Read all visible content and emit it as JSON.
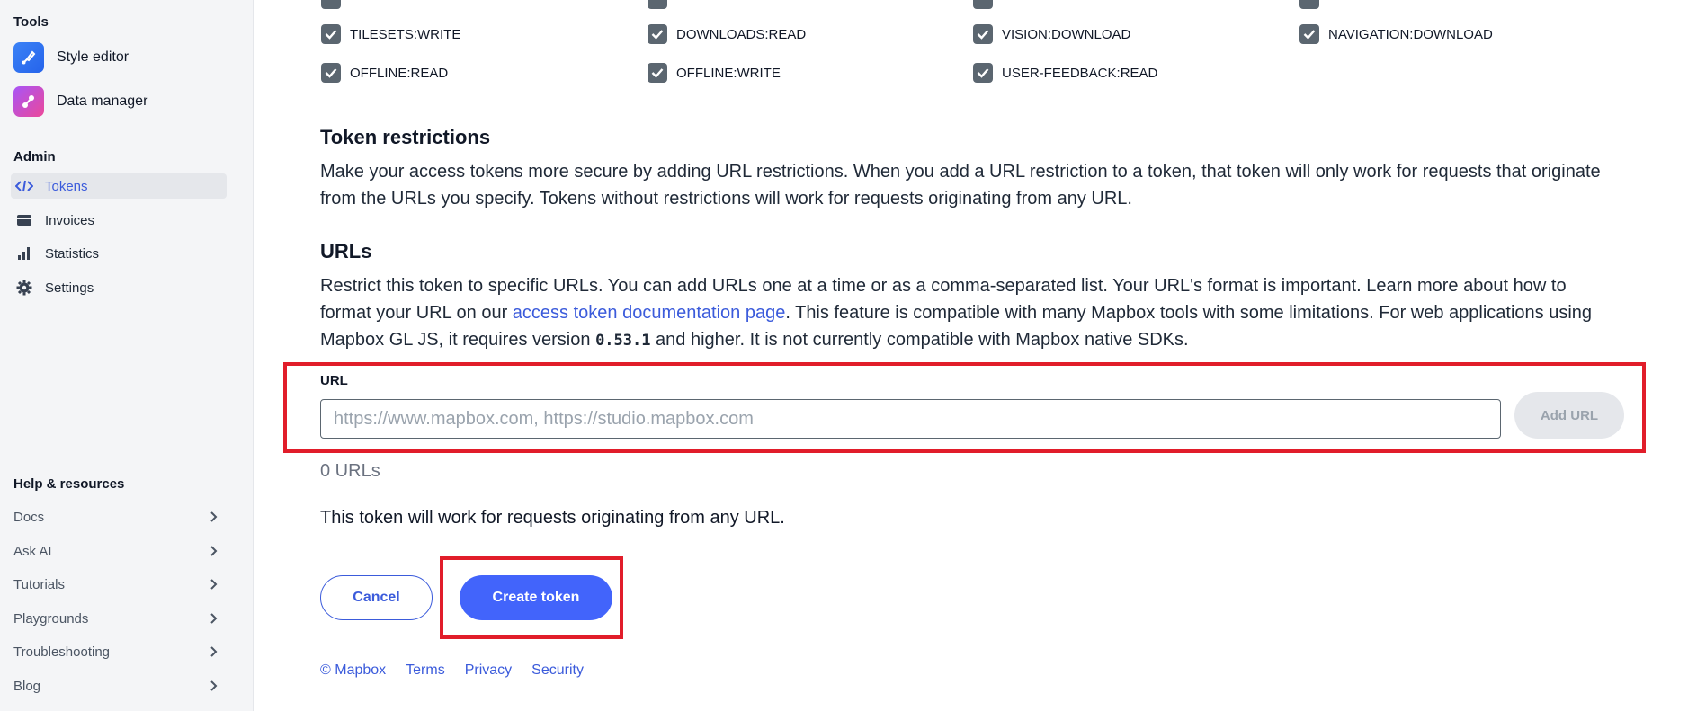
{
  "sidebar": {
    "tools_heading": "Tools",
    "tools": [
      {
        "label": "Style editor",
        "icon": "style-editor-icon"
      },
      {
        "label": "Data manager",
        "icon": "data-manager-icon"
      }
    ],
    "admin_heading": "Admin",
    "admin_items": [
      {
        "label": "Tokens",
        "icon": "code-brackets-icon",
        "active": true
      },
      {
        "label": "Invoices",
        "icon": "card-icon",
        "active": false
      },
      {
        "label": "Statistics",
        "icon": "bar-chart-icon",
        "active": false
      },
      {
        "label": "Settings",
        "icon": "gear-icon",
        "active": false
      }
    ],
    "help_heading": "Help & resources",
    "help_items": [
      "Docs",
      "Ask AI",
      "Tutorials",
      "Playgrounds",
      "Troubleshooting",
      "Blog"
    ]
  },
  "scopes": {
    "row1": [
      "TILESETS:WRITE",
      "DOWNLOADS:READ",
      "VISION:DOWNLOAD",
      "NAVIGATION:DOWNLOAD"
    ],
    "row2": [
      "OFFLINE:READ",
      "OFFLINE:WRITE",
      "USER-FEEDBACK:READ"
    ]
  },
  "restrictions": {
    "heading": "Token restrictions",
    "text": "Make your access tokens more secure by adding URL restrictions. When you add a URL restriction to a token, that token will only work for requests that originate from the URLs you specify. Tokens without restrictions will work for requests originating from any URL."
  },
  "urls": {
    "heading": "URLs",
    "text_before_link": "Restrict this token to specific URLs. You can add URLs one at a time or as a comma-separated list. Your URL's format is important. Learn more about how to format your URL on our ",
    "link_text": "access token documentation page",
    "text_after_link": ". This feature is compatible with many Mapbox tools with some limitations. For web applications using Mapbox GL JS, it requires version ",
    "version": "0.53.1",
    "text_end": " and higher. It is not currently compatible with Mapbox native SDKs.",
    "field_label": "URL",
    "placeholder": "https://www.mapbox.com, https://studio.mapbox.com",
    "add_button": "Add URL",
    "count": "0 URLs",
    "status": "This token will work for requests originating from any URL."
  },
  "actions": {
    "cancel": "Cancel",
    "create": "Create token"
  },
  "footer": [
    "© Mapbox",
    "Terms",
    "Privacy",
    "Security"
  ],
  "colors": {
    "accent": "#4264fb",
    "highlight": "#e11d2a",
    "checkbox": "#5b6670"
  }
}
